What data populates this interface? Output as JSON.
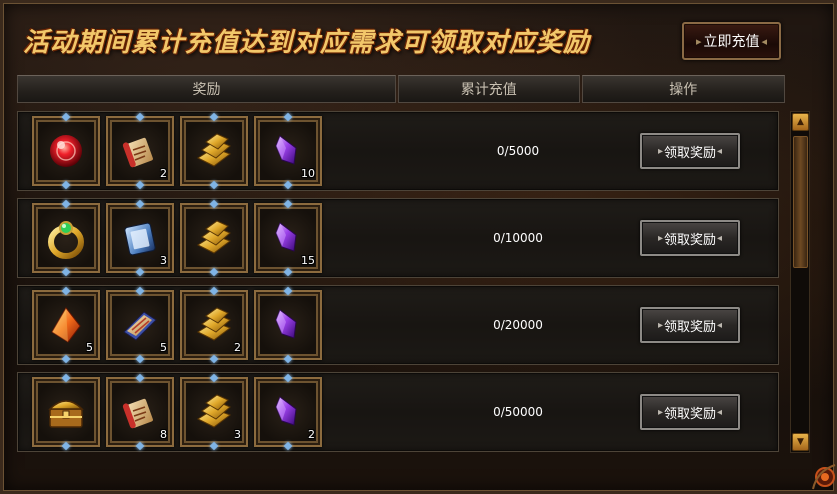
{
  "banner": {
    "title": "活动期间累计充值达到对应需求可领取对应奖励",
    "recharge_button": "立即充值"
  },
  "table": {
    "headers": [
      "奖励",
      "累计充值",
      "操作"
    ]
  },
  "rows": [
    {
      "progress": "0/5000",
      "claim_label": "领取奖励",
      "items": [
        {
          "icon": "red-orb-icon",
          "qty": ""
        },
        {
          "icon": "scroll-icon",
          "qty": "2"
        },
        {
          "icon": "gold-bars-icon",
          "qty": ""
        },
        {
          "icon": "purple-crystal-icon",
          "qty": "10"
        }
      ]
    },
    {
      "progress": "0/10000",
      "claim_label": "领取奖励",
      "items": [
        {
          "icon": "emerald-ring-icon",
          "qty": ""
        },
        {
          "icon": "blue-book-icon",
          "qty": "3"
        },
        {
          "icon": "gold-bars-icon",
          "qty": ""
        },
        {
          "icon": "purple-crystal-icon",
          "qty": "15"
        }
      ]
    },
    {
      "progress": "0/20000",
      "claim_label": "领取奖励",
      "items": [
        {
          "icon": "fire-gem-icon",
          "qty": "5"
        },
        {
          "icon": "red-tome-icon",
          "qty": "5"
        },
        {
          "icon": "gold-bars-icon",
          "qty": "2"
        },
        {
          "icon": "purple-crystal-icon",
          "qty": ""
        }
      ]
    },
    {
      "progress": "0/50000",
      "claim_label": "领取奖励",
      "items": [
        {
          "icon": "treasure-chest-icon",
          "qty": ""
        },
        {
          "icon": "scroll-icon",
          "qty": "8"
        },
        {
          "icon": "gold-bars-icon",
          "qty": "3"
        },
        {
          "icon": "purple-crystal-icon",
          "qty": "2"
        }
      ]
    }
  ],
  "colors": {
    "banner_text": "#f2c76a",
    "slot_border": "#8c6b3e",
    "scroll_accent": "#e9b44a"
  }
}
